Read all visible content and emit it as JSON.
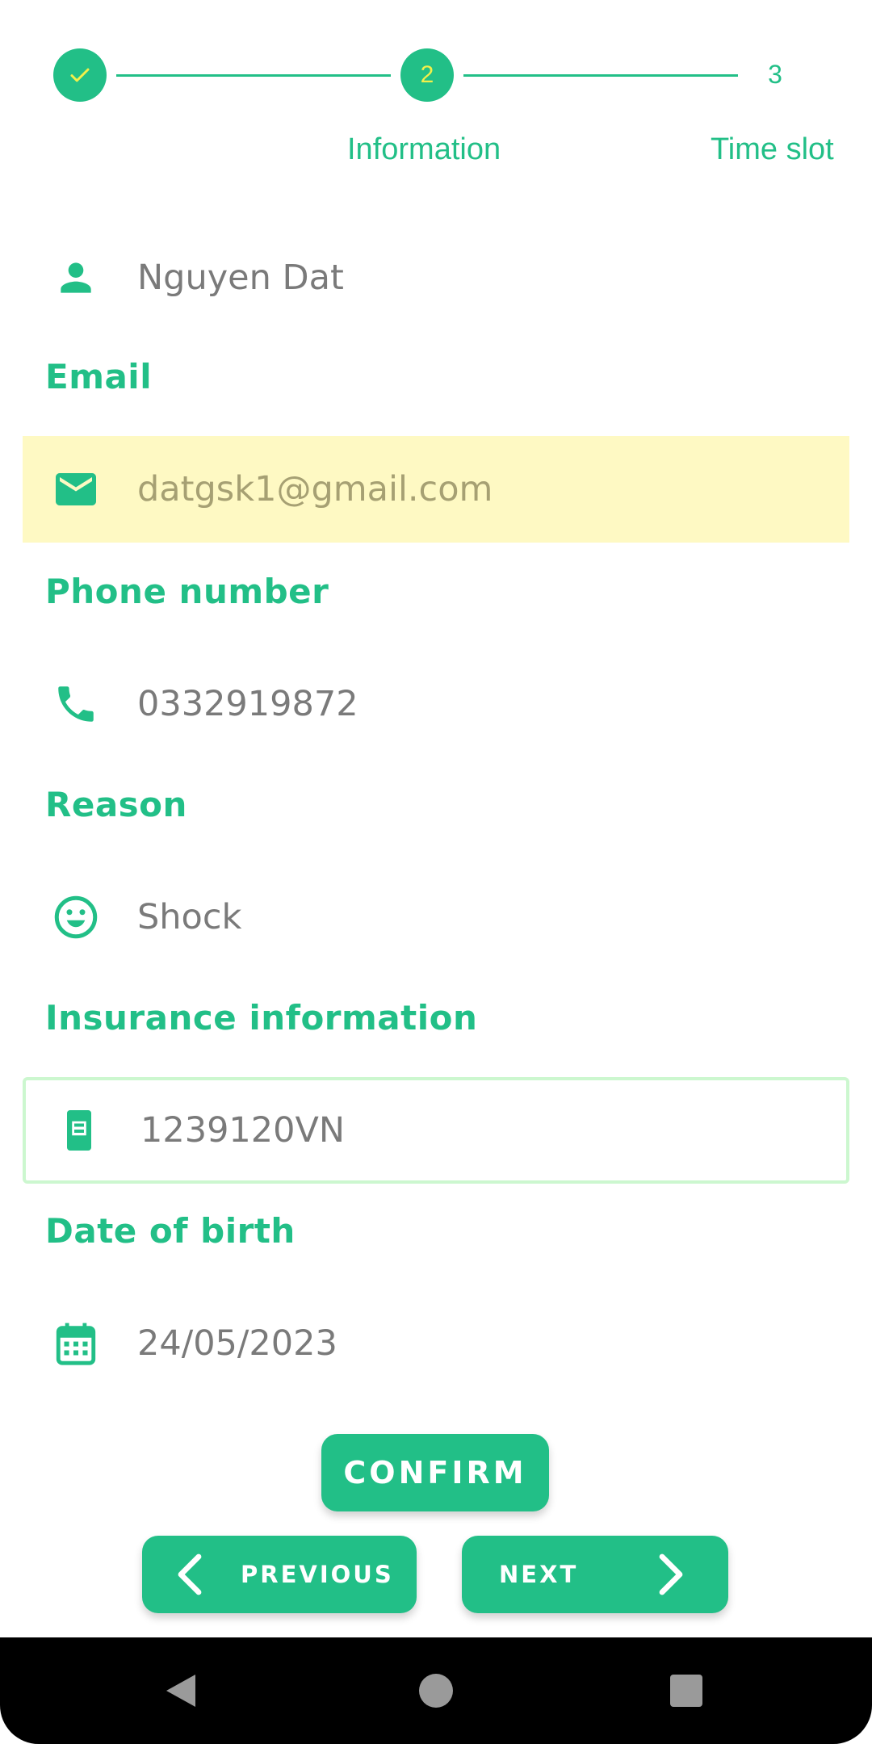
{
  "stepper": {
    "steps": [
      {
        "number": "",
        "label": "",
        "state": "completed"
      },
      {
        "number": "2",
        "label": "Information",
        "state": "active"
      },
      {
        "number": "3",
        "label": "Time slot",
        "state": "upcoming"
      }
    ]
  },
  "form": {
    "name": {
      "value": "Nguyen Dat",
      "icon": "person-icon"
    },
    "email": {
      "label": "Email",
      "value": "datgsk1@gmail.com",
      "icon": "mail-icon"
    },
    "phone": {
      "label": "Phone number",
      "value": "0332919872",
      "icon": "phone-icon"
    },
    "reason": {
      "label": "Reason",
      "value": "Shock",
      "icon": "smiley-icon"
    },
    "insurance": {
      "label": "Insurance information",
      "value": "1239120VN",
      "icon": "card-icon"
    },
    "dob": {
      "label": "Date of birth",
      "value": "24/05/2023",
      "icon": "calendar-icon"
    }
  },
  "buttons": {
    "confirm": "CONFIRM",
    "previous": "PREVIOUS",
    "next": "NEXT"
  },
  "colors": {
    "accent": "#22bf87",
    "highlight": "#fef9c3",
    "outline": "#ccf7cf",
    "value_text": "#7a7a7a"
  }
}
